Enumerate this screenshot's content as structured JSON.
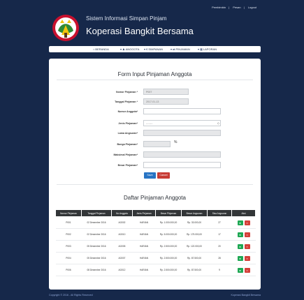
{
  "topbar": {
    "links": [
      "Pembimbin",
      "Pesan",
      "Logout"
    ]
  },
  "header": {
    "subtitle": "Sistem Informasi Simpan Pinjam",
    "title": "Koperasi Bangkit Bersama",
    "logo_icon": "koperasi-logo"
  },
  "nav": {
    "items": [
      {
        "label": "BERANDA",
        "icon": "home-icon"
      },
      {
        "label": "ANGGOTA",
        "icon": "user-icon"
      },
      {
        "label": "SIMPANAN",
        "icon": "money-icon"
      },
      {
        "label": "PINJAMAN",
        "icon": "transfer-icon"
      },
      {
        "label": "LAPORAN",
        "icon": "report-icon"
      }
    ]
  },
  "form": {
    "title": "Form Input Pinjaman Anggota",
    "fields": [
      {
        "label": "Nomor Pinjaman",
        "value": "P007",
        "readonly": true
      },
      {
        "label": "Tanggal Pinjaman",
        "value": "2017-01-13",
        "readonly": true
      },
      {
        "label": "Nomor Anggota",
        "value": "",
        "readonly": false
      },
      {
        "label": "Jenis Pinjaman",
        "value": "--------",
        "readonly": false
      },
      {
        "label": "Lama Angsuran",
        "value": "",
        "readonly": true
      },
      {
        "label": "Bunga Pinjaman",
        "value": "",
        "readonly": true
      },
      {
        "label": "Maksimal Pinjaman",
        "value": "",
        "readonly": true
      },
      {
        "label": "Besar Pinjaman",
        "value": "",
        "readonly": false
      }
    ],
    "percent": "%",
    "save_label": "Save",
    "cancel_label": "Cancel"
  },
  "list": {
    "title": "Daftar Pinjaman Anggota",
    "columns": [
      "Nomor Pinjaman",
      "Tanggal Pinjaman",
      "No Anggota",
      "Jenis Pinjaman",
      "Besar Pinjaman",
      "Besar Angsuran",
      "Sisa Angsuran",
      "Aksi"
    ],
    "rows": [
      [
        "P001",
        "02 Desember 2016",
        "AG002",
        "HARIAN",
        "Rp. 1.000.000,00",
        "Rp. 33.000,00",
        "27"
      ],
      [
        "P002",
        "02 Desember 2016",
        "AG010",
        "HARIAN",
        "Rp. 5.000.000,00",
        "Rp. 175.000,00",
        "17"
      ],
      [
        "P003",
        "05 Desember 2016",
        "AG005",
        "HARIAN",
        "Rp. 2.500.000,00",
        "Rp. 122.000,00",
        "20"
      ],
      [
        "P004",
        "05 Desember 2016",
        "AG007",
        "HARIAN",
        "Rp. 2.500.000,00",
        "Rp. 87.500,00",
        "28"
      ],
      [
        "P006",
        "08 Desember 2016",
        "AG012",
        "HARIAN",
        "Rp. 2.500.000,00",
        "Rp. 87.500,00",
        "9"
      ]
    ]
  },
  "footer": {
    "left": "Copyright © 2016 - All Rights Reserved",
    "right": "Koperasi Bangkit Bersama"
  }
}
